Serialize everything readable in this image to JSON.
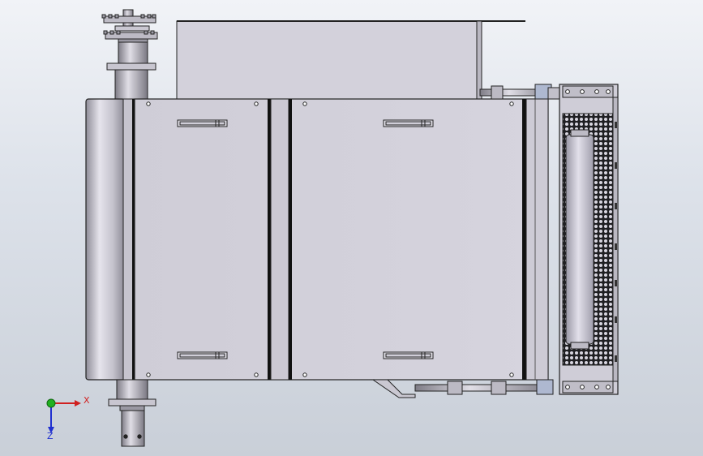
{
  "viewport": {
    "background_top": "#f1f3f7",
    "background_bottom": "#c9cfd8"
  },
  "model": {
    "part_color": "#d4d2dc",
    "edge_color": "#1a1a1a",
    "roller_color": "#c9c7d8",
    "mesh_color": "#2b2b2b"
  },
  "triad": {
    "x_label": "X",
    "z_label": "Z",
    "x_color": "#d02020",
    "y_color": "#20b020",
    "z_color": "#2030d0"
  }
}
